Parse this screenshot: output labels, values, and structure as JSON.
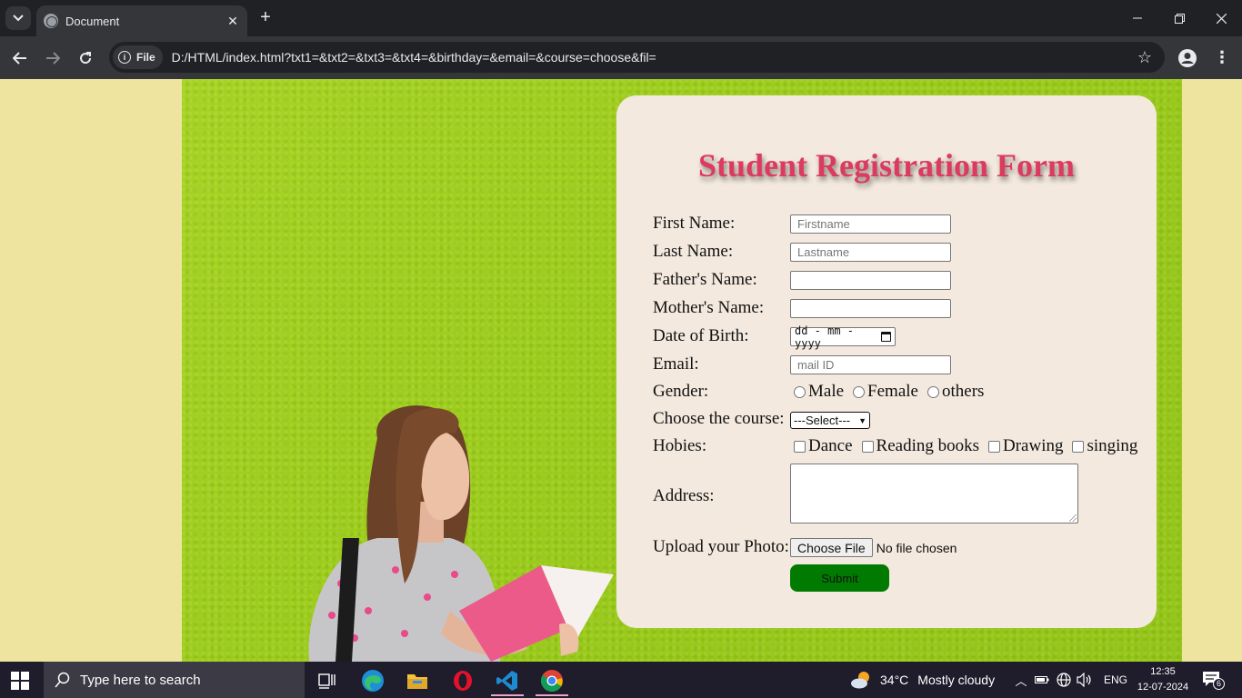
{
  "browser": {
    "tab_title": "Document",
    "url_chip": "File",
    "url": "D:/HTML/index.html?txt1=&txt2=&txt3=&txt4=&birthday=&email=&course=choose&fil="
  },
  "form": {
    "title": "Student Registration Form",
    "labels": {
      "first_name": "First Name:",
      "last_name": "Last Name:",
      "father_name": "Father's Name:",
      "mother_name": "Mother's Name:",
      "dob": "Date of Birth:",
      "email": "Email:",
      "gender": "Gender:",
      "course": "Choose the course:",
      "hobbies": "Hobies:",
      "address": "Address:",
      "photo": "Upload your Photo:"
    },
    "placeholders": {
      "first_name": "Firstname",
      "last_name": "Lastname",
      "email": "mail ID"
    },
    "dob_placeholder": "dd - mm - yyyy",
    "gender_options": [
      "Male",
      "Female",
      "others"
    ],
    "course_selected": "---Select---",
    "hobbies": [
      "Dance",
      "Reading books",
      "Drawing",
      "singing"
    ],
    "file_button": "Choose File",
    "file_status": "No file chosen",
    "submit_label": "Submit"
  },
  "taskbar": {
    "search_placeholder": "Type here to search",
    "temperature": "34°C",
    "weather": "Mostly cloudy",
    "language": "ENG",
    "time": "12:35",
    "date": "12-07-2024",
    "notification_count": "6"
  },
  "colors": {
    "page_bg": "#eee49f",
    "card_bg": "#f3e9de",
    "title": "#dc3a5f",
    "submit": "#007a00"
  }
}
